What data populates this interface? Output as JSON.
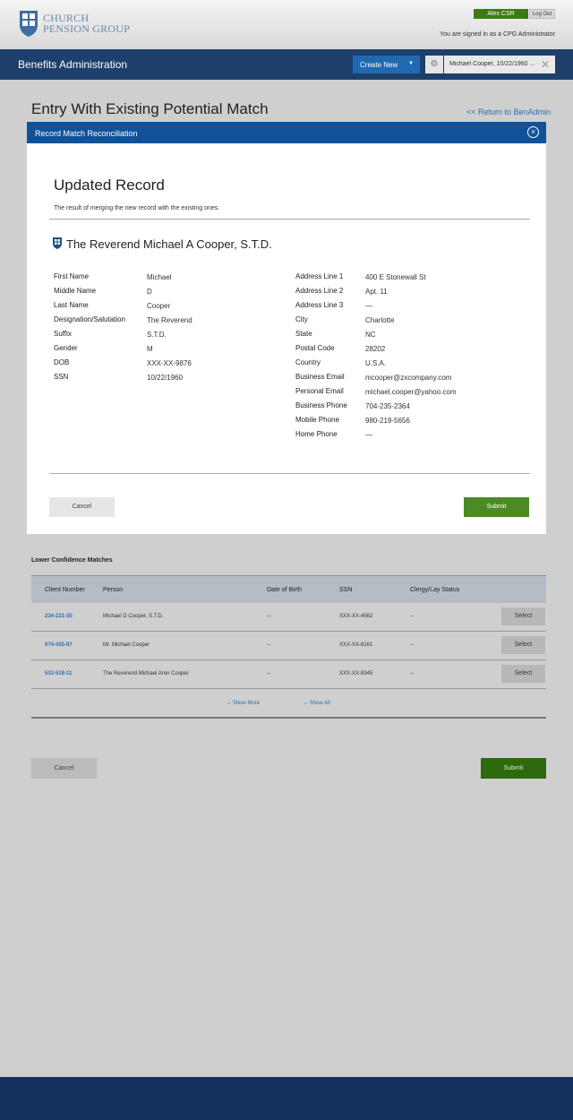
{
  "header": {
    "logo_line1": "CHURCH",
    "logo_line2": "PENSION GROUP",
    "user_label": "Alex CSR",
    "logout_label": "Log Out",
    "signed_in_text": "You are signed in as a CPG Administrator"
  },
  "navbar": {
    "title": "Benefits Administration",
    "create_new_label": "Create New",
    "search_value": "Michael Cooper, 10/22/1960 ..."
  },
  "page": {
    "title": "Entry With Existing Potential Match",
    "return_link": "<< Return to BenAdmin"
  },
  "modal": {
    "title": "Record Match Reconciliation",
    "section_title": "Updated Record",
    "section_desc": "The result of merging the new record with the existing ones.",
    "record_name": "The Reverend Michael A Cooper, S.T.D.",
    "left_fields": [
      {
        "label": "First Name",
        "value": "Michael"
      },
      {
        "label": "Middle Name",
        "value": "D"
      },
      {
        "label": "Last Name",
        "value": "Cooper"
      },
      {
        "label": "Designation/Salutation",
        "value": "The Reverend"
      },
      {
        "label": "Suffix",
        "value": "S.T.D."
      },
      {
        "label": "Gender",
        "value": "M"
      },
      {
        "label": "DOB",
        "value": "XXX-XX-9876"
      },
      {
        "label": "SSN",
        "value": "10/22/1960"
      }
    ],
    "right_fields": [
      {
        "label": "Address Line 1",
        "value": "400 E Stonewall St"
      },
      {
        "label": "Address Line 2",
        "value": "Apt. 11"
      },
      {
        "label": "Address Line 3",
        "value": "—"
      },
      {
        "label": "City",
        "value": "Charlotte"
      },
      {
        "label": "State",
        "value": "NC"
      },
      {
        "label": "Postal Code",
        "value": "28202"
      },
      {
        "label": "Country",
        "value": "U.S.A."
      },
      {
        "label": "Business Email",
        "value": "mcooper@zxcompany.com"
      },
      {
        "label": "Personal Email",
        "value": "michael.cooper@yahoo.com"
      },
      {
        "label": "Business Phone",
        "value": "704-235-2364"
      },
      {
        "label": "Mobile Phone",
        "value": "980-219-5656"
      },
      {
        "label": "Home Phone",
        "value": "—"
      }
    ],
    "cancel_label": "Cancel",
    "submit_label": "Submit"
  },
  "lower": {
    "heading": "Lower Confidence Matches",
    "columns": [
      "Client Number",
      "Person",
      "Date of Birth",
      "SSN",
      "Clergy/Lay Status"
    ],
    "rows": [
      {
        "client_number": "234-221-35",
        "person": "Michael D Cooper, S.T.D.",
        "dob": "--",
        "ssn": "XXX-XX-4562",
        "status": "--",
        "action": "Select"
      },
      {
        "client_number": "674-435-87",
        "person": "Mr. Michael Cooper",
        "dob": "--",
        "ssn": "XXX-XX-8161",
        "status": "--",
        "action": "Select"
      },
      {
        "client_number": "533-518-11",
        "person": "The Reverend Michael Aron Cooper",
        "dob": "--",
        "ssn": "XXX-XX-8345",
        "status": "--",
        "action": "Select"
      }
    ],
    "show_more": "Show More",
    "show_all": "Show All",
    "cancel_label": "Cancel",
    "submit_label": "Submit"
  },
  "colors": {
    "navbar": "#1d3f6b",
    "modal_header": "#0f5299",
    "submit_green": "#4c8a25",
    "link_blue": "#2c6db4",
    "footer": "#13315c"
  }
}
